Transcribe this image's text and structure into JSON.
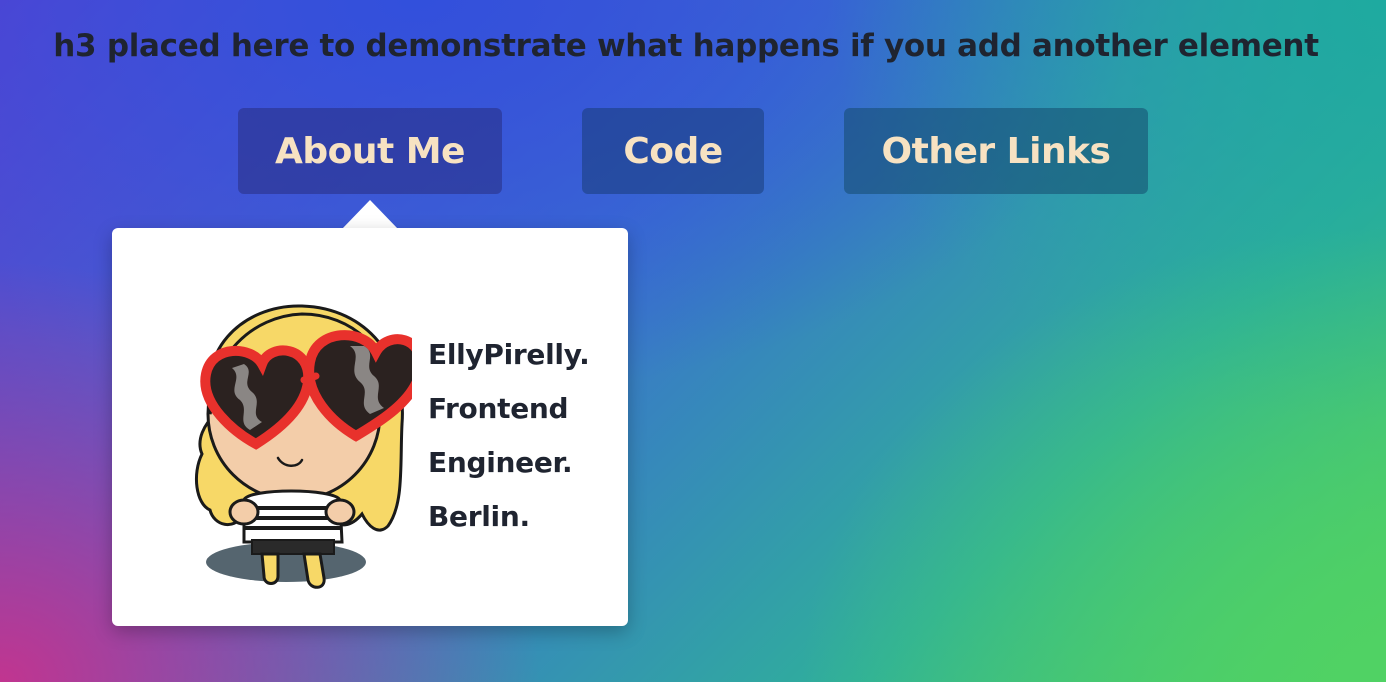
{
  "heading": "h3 placed here to demonstrate what happens if you add another element",
  "nav": {
    "about": "About Me",
    "code": "Code",
    "links": "Other Links"
  },
  "popover": {
    "avatar_icon": "cartoon-girl-heart-sunglasses",
    "lines": [
      "EllyPirelly.",
      "Frontend",
      "Engineer.",
      "Berlin."
    ]
  },
  "colors": {
    "button_text": "#f7e2c2",
    "heading_text": "#1f2430",
    "popover_bg": "#ffffff"
  }
}
